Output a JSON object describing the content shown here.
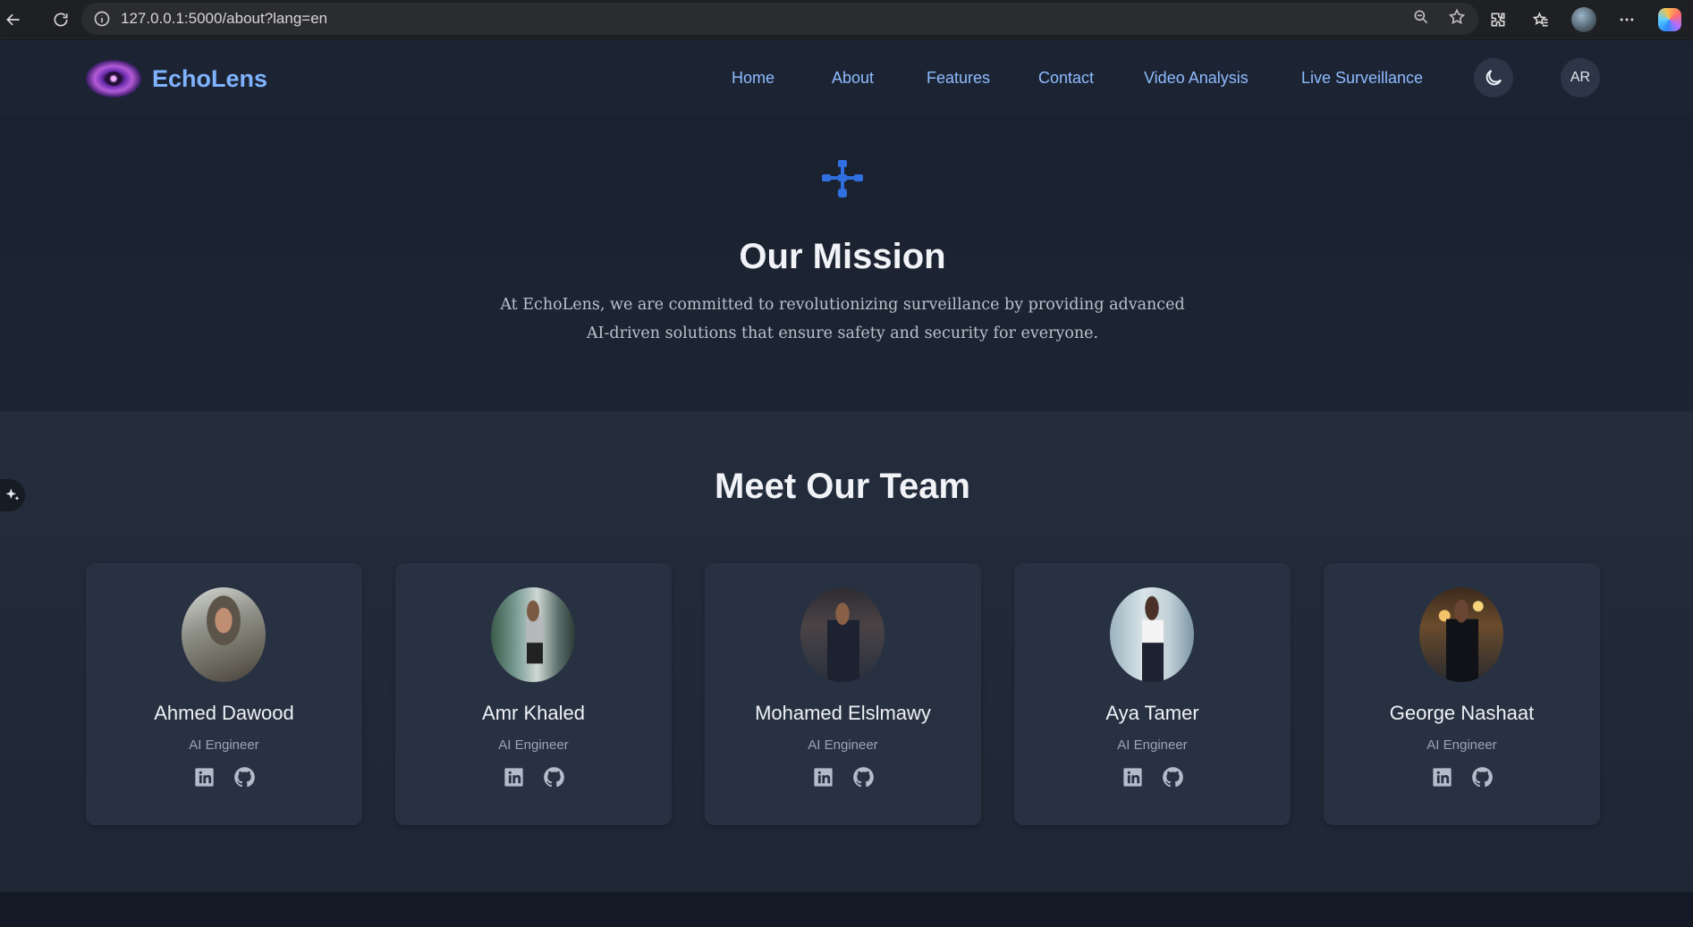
{
  "browser": {
    "url": "127.0.0.1:5000/about?lang=en",
    "icons": [
      "back-arrow-icon",
      "reload-icon",
      "info-icon",
      "zoom-out-icon",
      "star-icon",
      "extensions-icon",
      "favorites-icon",
      "profile-avatar",
      "more-icon",
      "copilot-icon"
    ]
  },
  "nav": {
    "brand": "EchoLens",
    "links": [
      "Home",
      "About",
      "Features",
      "Contact",
      "Video Analysis",
      "Live Surveillance"
    ],
    "lang_button": "AR",
    "theme_icon": "moon-icon"
  },
  "mission": {
    "icon": "network-icon",
    "title": "Our Mission",
    "text_line1": "At EchoLens, we are committed to revolutionizing surveillance by providing advanced",
    "text_line2": "AI-driven solutions that ensure safety and security for everyone."
  },
  "team": {
    "title": "Meet Our Team",
    "members": [
      {
        "name": "Ahmed Dawood",
        "role": "AI Engineer"
      },
      {
        "name": "Amr Khaled",
        "role": "AI Engineer"
      },
      {
        "name": "Mohamed Elslmawy",
        "role": "AI Engineer"
      },
      {
        "name": "Aya Tamer",
        "role": "AI Engineer"
      },
      {
        "name": "George Nashaat",
        "role": "AI Engineer"
      }
    ]
  },
  "colors": {
    "accent": "#8ebbff",
    "brand": "#7fb2ff",
    "mission_icon": "#2f6fe0"
  }
}
